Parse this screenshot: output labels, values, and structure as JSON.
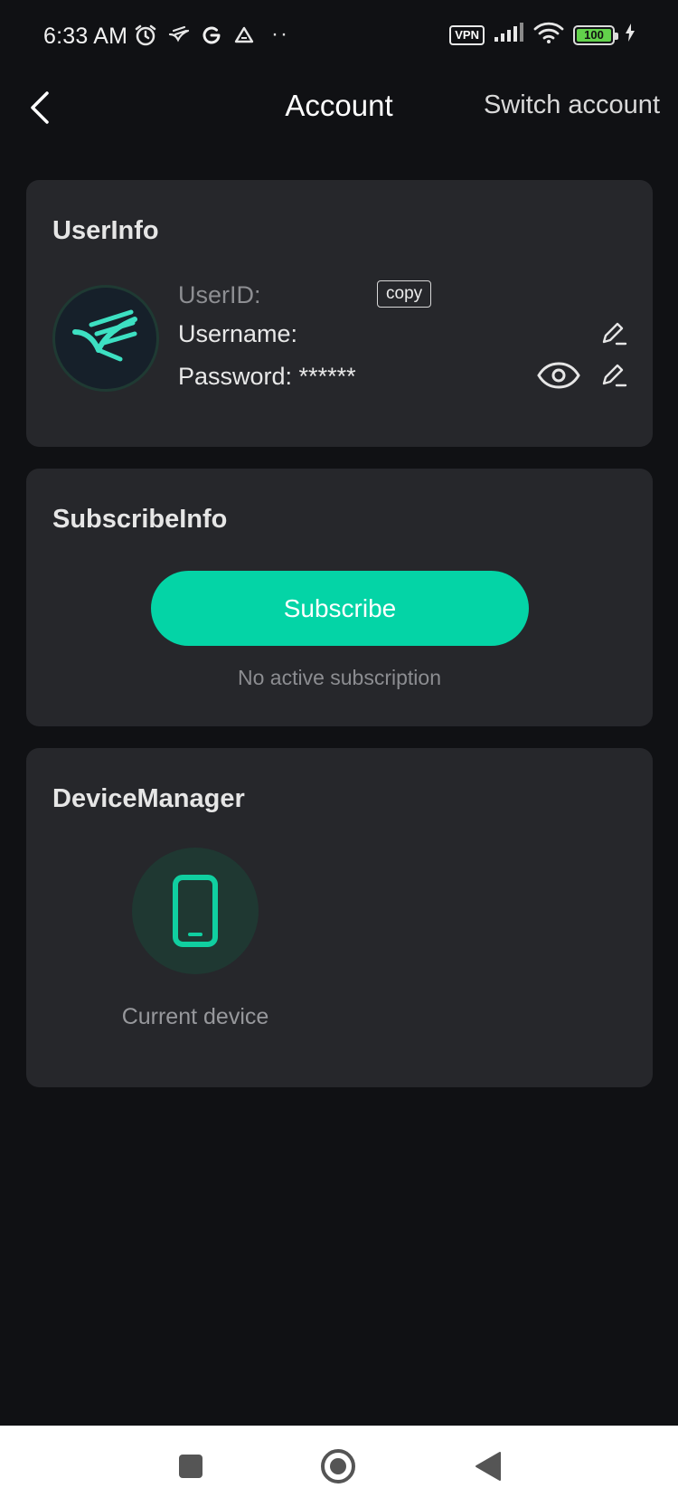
{
  "status_bar": {
    "time": "6:33 AM",
    "dots": "··",
    "vpn": "VPN",
    "battery": "100",
    "battery_color": "#62d14b"
  },
  "header": {
    "title": "Account",
    "switch_account": "Switch account",
    "back_icon": "chevron-left-icon"
  },
  "user_info": {
    "title": "UserInfo",
    "userid_label": "UserID:",
    "copy_label": "copy",
    "username_label": "Username:",
    "password_label": "Password: ******"
  },
  "subscribe_info": {
    "title": "SubscribeInfo",
    "button_label": "Subscribe",
    "status": "No active subscription",
    "accent": "#04d4a6"
  },
  "device_manager": {
    "title": "DeviceManager",
    "device_label": "Current device",
    "device_icon": "phone-icon"
  },
  "nav": {
    "recents_icon": "square-icon",
    "home_icon": "circle-icon",
    "back_icon": "triangle-back-icon"
  }
}
